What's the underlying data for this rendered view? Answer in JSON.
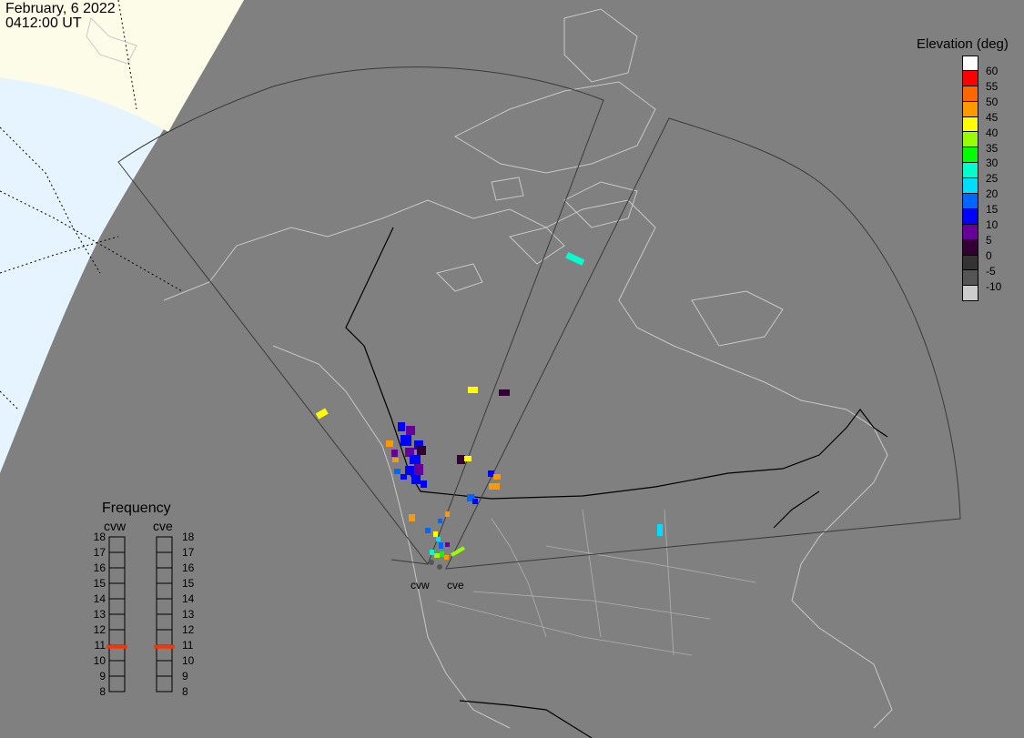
{
  "header": {
    "date": "February, 6 2022",
    "time": "0412:00 UT"
  },
  "legend": {
    "title": "Elevation (deg)",
    "levels": [
      {
        "label": "60",
        "color": "#ffffff"
      },
      {
        "label": "55",
        "color": "#ff0000"
      },
      {
        "label": "50",
        "color": "#ff6600"
      },
      {
        "label": "45",
        "color": "#ff9900"
      },
      {
        "label": "40",
        "color": "#ffff00"
      },
      {
        "label": "35",
        "color": "#99ff00"
      },
      {
        "label": "30",
        "color": "#00ff00"
      },
      {
        "label": "25",
        "color": "#00ffcc"
      },
      {
        "label": "20",
        "color": "#00ddff"
      },
      {
        "label": "15",
        "color": "#0066ff"
      },
      {
        "label": "10",
        "color": "#0000ff"
      },
      {
        "label": "5",
        "color": "#660099"
      },
      {
        "label": "0",
        "color": "#330033"
      },
      {
        "label": "-5",
        "color": "#333333"
      },
      {
        "label": "-10",
        "color": "#555555"
      },
      {
        "label": "",
        "color": "#cccccc"
      }
    ]
  },
  "frequency": {
    "title": "Frequency",
    "radars": [
      "cvw",
      "cve"
    ],
    "ticks": [
      "18",
      "17",
      "16",
      "15",
      "14",
      "13",
      "12",
      "11",
      "10",
      "9",
      "8"
    ],
    "cvw_mhz": 10.9,
    "cve_mhz": 10.9
  },
  "sites": {
    "west": "cvw",
    "east": "cve"
  },
  "colors": {
    "background": "#808080",
    "daylight": "#e6f4ff",
    "ice": "#fcfce8",
    "outline": "#c8c8c8",
    "marker": "#ff3300"
  }
}
